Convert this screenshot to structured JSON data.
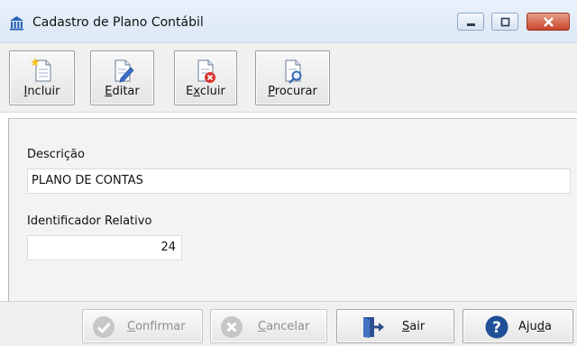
{
  "window": {
    "title": "Cadastro de Plano Contábil"
  },
  "toolbar": {
    "incluir": {
      "key": "I",
      "rest": "ncluir"
    },
    "editar": {
      "key": "E",
      "rest": "ditar"
    },
    "excluir": {
      "pre": "E",
      "key": "x",
      "rest": "cluir"
    },
    "procurar": {
      "key": "P",
      "rest": "rocurar"
    }
  },
  "form": {
    "descricao_label": "Descrição",
    "descricao_value": "PLANO DE CONTAS",
    "identificador_label": "Identificador Relativo",
    "identificador_value": "24"
  },
  "actions": {
    "confirmar": {
      "key": "C",
      "rest": "onfirmar",
      "enabled": false
    },
    "cancelar": {
      "key": "C",
      "rest": "ancelar",
      "enabled": false
    },
    "sair": {
      "key": "S",
      "rest": "air",
      "enabled": true
    },
    "ajuda": {
      "pre": "Aju",
      "key": "d",
      "rest": "a",
      "enabled": true
    }
  }
}
